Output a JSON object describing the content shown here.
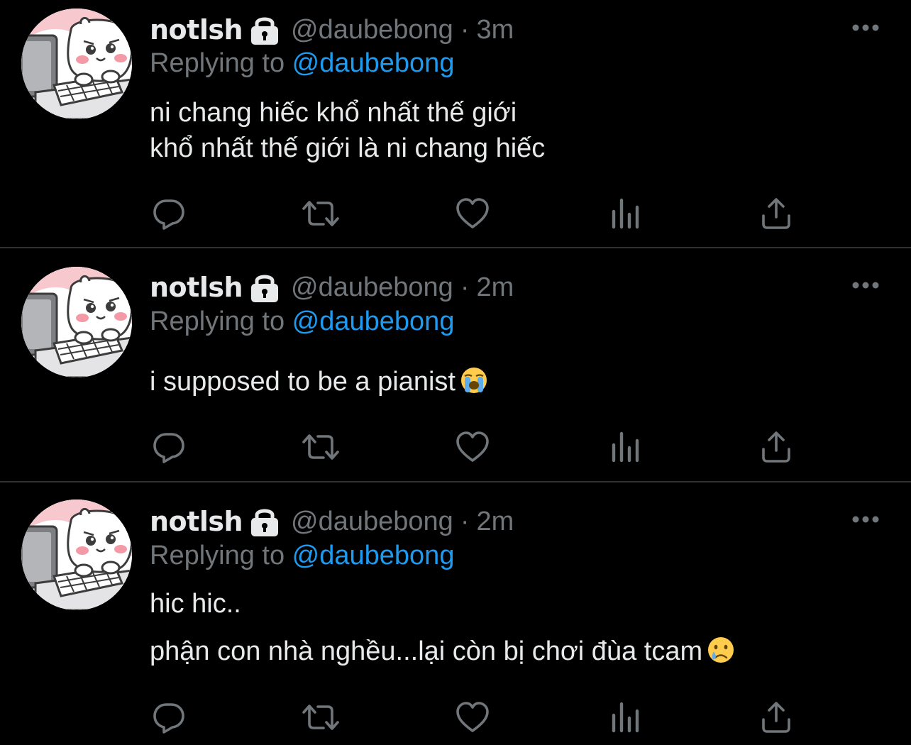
{
  "tweets": [
    {
      "name": "notlsh",
      "handle": "@daubebong",
      "sep": "·",
      "time": "3m",
      "reply_prefix": "Replying to ",
      "reply_to": "@daubebong",
      "lines": [
        "ni chang hiếc khổ nhất thế giới",
        "khổ nhất thế giới là ni chang hiếc"
      ],
      "emoji": "",
      "emoji_name": ""
    },
    {
      "name": "notlsh",
      "handle": "@daubebong",
      "sep": "·",
      "time": "2m",
      "reply_prefix": "Replying to ",
      "reply_to": "@daubebong",
      "lines": [
        "i supposed to be a pianist"
      ],
      "emoji": "😭",
      "emoji_name": "loudly-crying-face-emoji"
    },
    {
      "name": "notlsh",
      "handle": "@daubebong",
      "sep": "·",
      "time": "2m",
      "reply_prefix": "Replying to ",
      "reply_to": "@daubebong",
      "lines": [
        "hic hic..",
        "phận con nhà nghều...lại còn bị chơi đùa tcam"
      ],
      "emoji": "😢",
      "emoji_name": "crying-face-emoji"
    }
  ],
  "icons": {
    "avatar": "hamster-at-computer-avatar",
    "lock": "lock-icon",
    "more": "more-options-icon",
    "reply": "reply-icon",
    "retweet": "retweet-icon",
    "like": "like-icon",
    "views": "views-icon",
    "share": "share-icon"
  },
  "colors": {
    "background": "#000000",
    "primary_text": "#e7e9ea",
    "secondary_text": "#71767b",
    "mention": "#1d9bf0",
    "divider": "#2f3336"
  }
}
